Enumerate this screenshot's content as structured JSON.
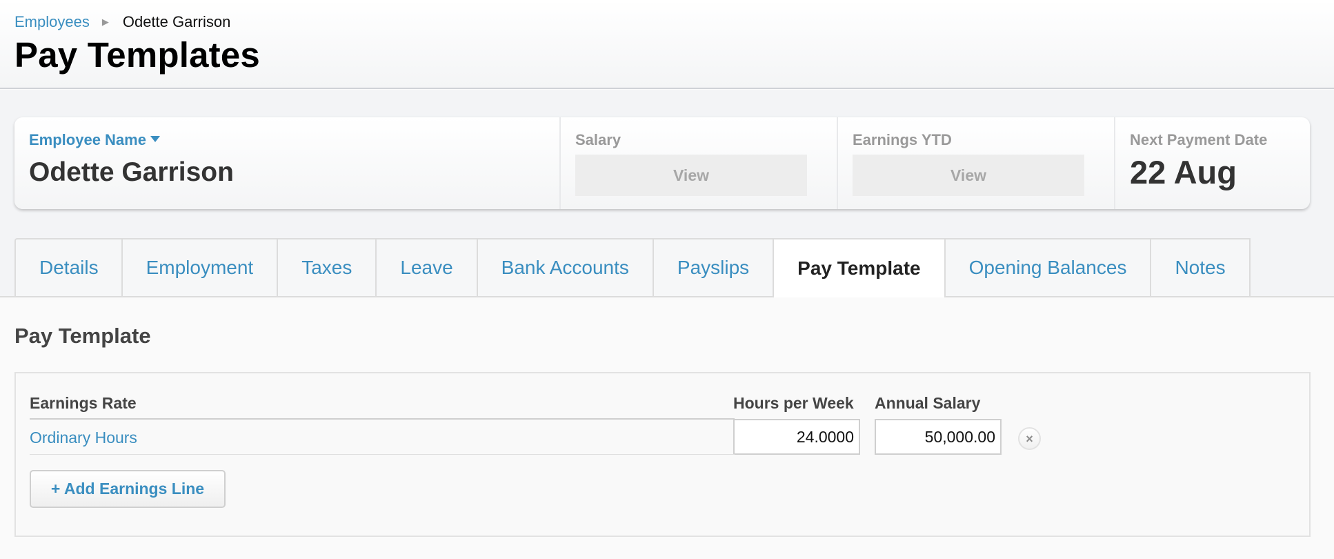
{
  "breadcrumb": {
    "parent": "Employees",
    "separator_icon": "chevron-right-icon",
    "current": "Odette Garrison"
  },
  "page_title": "Pay Templates",
  "summary": {
    "employee_label": "Employee Name",
    "employee_name": "Odette Garrison",
    "salary_label": "Salary",
    "salary_button": "View",
    "ytd_label": "Earnings YTD",
    "ytd_button": "View",
    "next_payment_label": "Next Payment Date",
    "next_payment_value": "22 Aug"
  },
  "tabs": [
    {
      "label": "Details",
      "active": false
    },
    {
      "label": "Employment",
      "active": false
    },
    {
      "label": "Taxes",
      "active": false
    },
    {
      "label": "Leave",
      "active": false
    },
    {
      "label": "Bank Accounts",
      "active": false
    },
    {
      "label": "Payslips",
      "active": false
    },
    {
      "label": "Pay Template",
      "active": true
    },
    {
      "label": "Opening Balances",
      "active": false
    },
    {
      "label": "Notes",
      "active": false
    }
  ],
  "section": {
    "title": "Pay Template",
    "columns": {
      "earnings_rate": "Earnings Rate",
      "hours_per_week": "Hours per Week",
      "annual_salary": "Annual Salary"
    },
    "rows": [
      {
        "earnings_rate": "Ordinary Hours",
        "hours_per_week": "24.0000",
        "annual_salary": "50,000.00"
      }
    ],
    "remove_icon": "close-icon",
    "add_button": "+ Add Earnings Line"
  },
  "colors": {
    "link": "#3a8ec0",
    "heading": "#444444",
    "muted": "#999999"
  }
}
